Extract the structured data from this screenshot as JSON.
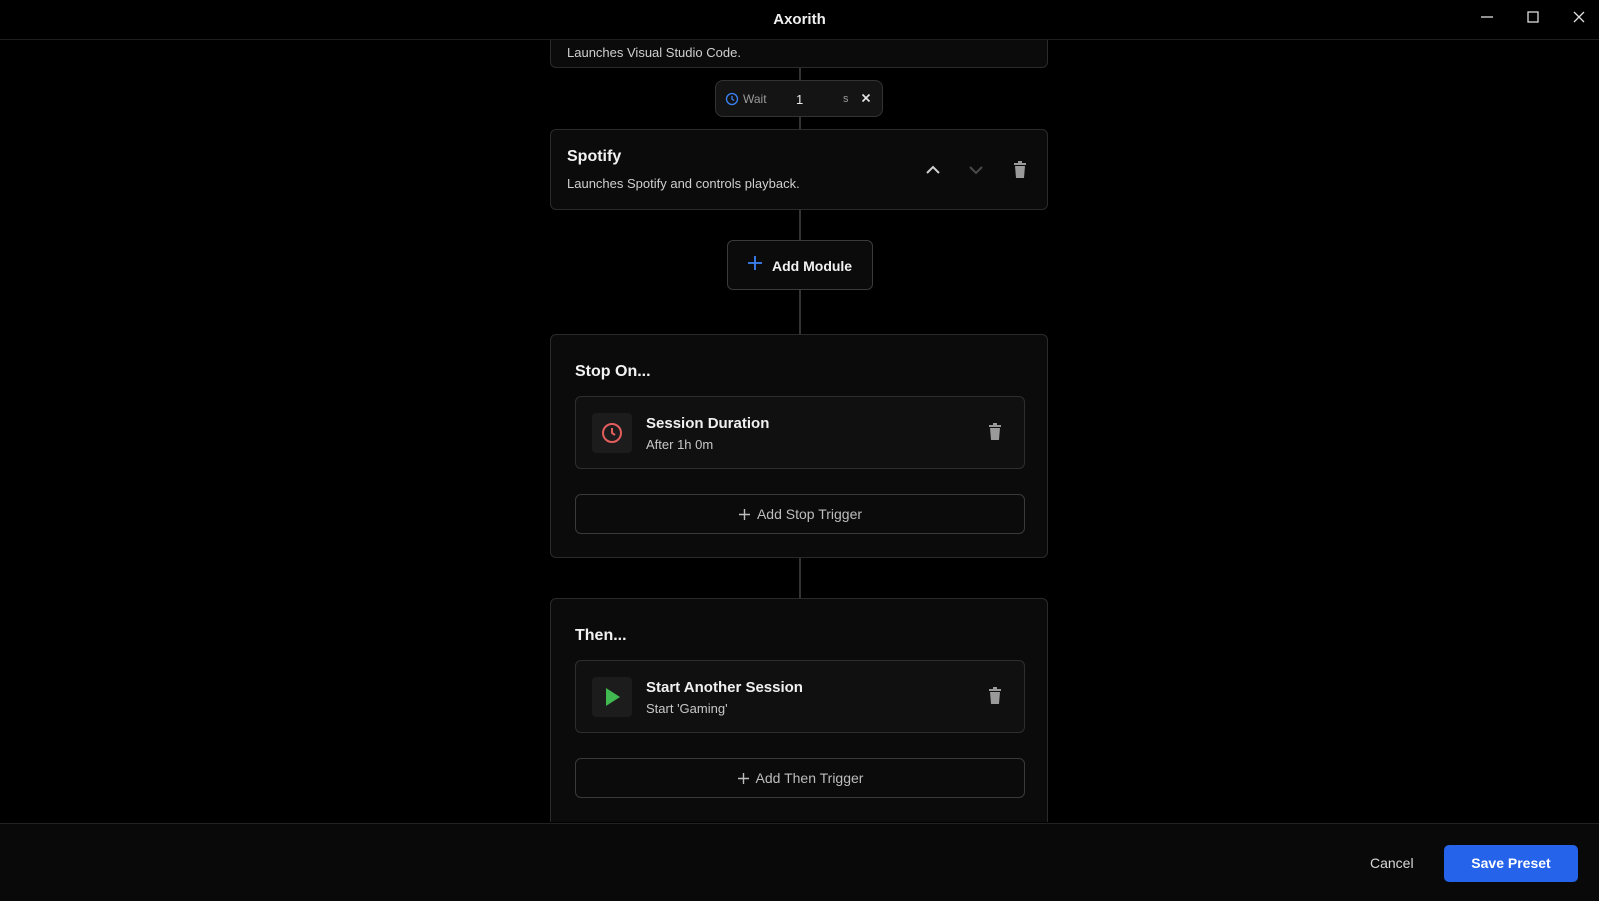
{
  "window": {
    "title": "Axorith"
  },
  "top_card": {
    "description": "Launches Visual Studio Code."
  },
  "wait": {
    "label": "Wait",
    "value": "1",
    "unit": "s"
  },
  "spotify": {
    "title": "Spotify",
    "description": "Launches Spotify and controls playback."
  },
  "add_module": {
    "label": "Add Module"
  },
  "stop_on": {
    "title": "Stop On...",
    "trigger": {
      "title": "Session Duration",
      "subtitle": "After 1h 0m",
      "icon": "clock-icon",
      "icon_color": "#e35d5d"
    },
    "add_label": "Add Stop Trigger"
  },
  "then": {
    "title": "Then...",
    "trigger": {
      "title": "Start Another Session",
      "subtitle": "Start 'Gaming'",
      "icon": "play-icon",
      "icon_color": "#3fb950"
    },
    "add_label": "Add Then Trigger"
  },
  "footer": {
    "cancel_label": "Cancel",
    "save_label": "Save Preset"
  },
  "colors": {
    "accent": "#2563eb",
    "wait_icon": "#3b82f6"
  }
}
